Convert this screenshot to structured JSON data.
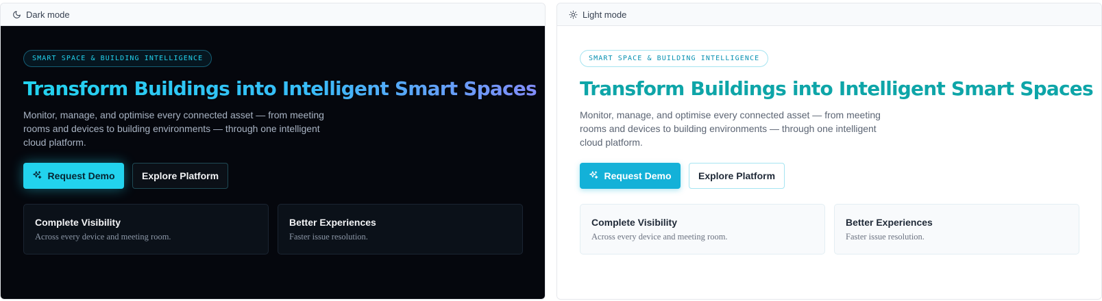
{
  "panels": {
    "dark": {
      "label": "Dark mode"
    },
    "light": {
      "label": "Light mode"
    }
  },
  "hero": {
    "eyebrow": "SMART SPACE & BUILDING INTELLIGENCE",
    "title": "Transform Buildings into Intelligent Smart Spaces",
    "subtitle": "Monitor, manage, and optimise every connected asset — from meeting rooms and devices to building environments — through one intelligent cloud platform.",
    "primary_cta": "Request Demo",
    "secondary_cta": "Explore Platform"
  },
  "features": [
    {
      "title": "Complete Visibility",
      "description": "Across every device and meeting room."
    },
    {
      "title": "Better Experiences",
      "description": "Faster issue resolution."
    }
  ],
  "icons": {
    "dark_header": "moon-icon",
    "light_header": "sun-icon",
    "primary_cta": "sparkle-icon"
  },
  "colors": {
    "dark_accent": "#22d3ee",
    "dark_gradient_end": "#818cf8",
    "light_accent": "#13b1d8",
    "light_title": "#0ea5a8"
  }
}
